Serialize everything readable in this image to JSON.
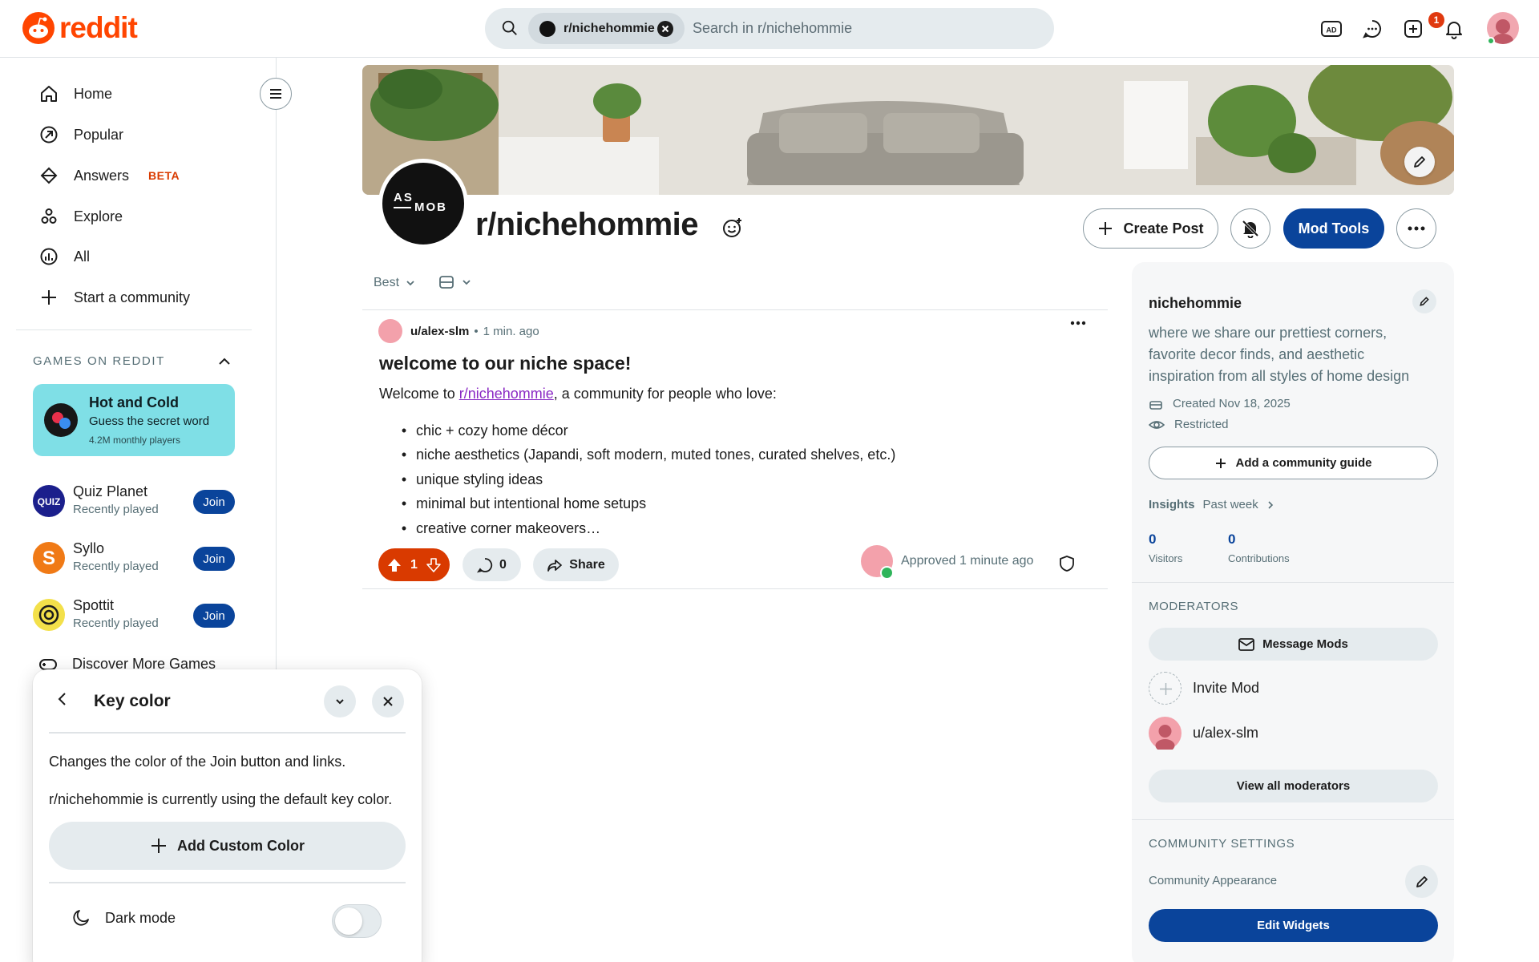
{
  "header": {
    "logo_text": "reddit",
    "search_chip": "r/nichehommie",
    "search_placeholder": "Search in r/nichehommie",
    "notification_count": "1",
    "icons": [
      "advertise-icon",
      "chat-icon",
      "create-icon",
      "notification-bell-icon"
    ]
  },
  "sidebar": {
    "nav": [
      {
        "label": "Home",
        "icon": "home-icon"
      },
      {
        "label": "Popular",
        "icon": "popular-icon"
      },
      {
        "label": "Answers",
        "icon": "answers-icon",
        "badge": "BETA"
      },
      {
        "label": "Explore",
        "icon": "explore-icon"
      },
      {
        "label": "All",
        "icon": "all-icon"
      },
      {
        "label": "Start a community",
        "icon": "plus-icon"
      }
    ],
    "games_section_title": "GAMES ON REDDIT",
    "featured_game": {
      "title": "Hot and Cold",
      "subtitle": "Guess the secret word",
      "players": "4.2M monthly players"
    },
    "games": [
      {
        "name": "Quiz Planet",
        "status": "Recently played",
        "join": "Join",
        "color": "#1b1f8c"
      },
      {
        "name": "Syllo",
        "status": "Recently played",
        "join": "Join",
        "color": "#f07a16"
      },
      {
        "name": "Spottit",
        "status": "Recently played",
        "join": "Join",
        "color": "#f3e04a"
      }
    ],
    "discover": "Discover More Games"
  },
  "popup": {
    "title": "Key color",
    "description": "Changes the color of the Join button and links.",
    "status": "r/nichehommie is currently using the default key color.",
    "add_button": "Add Custom Color",
    "dark_mode": "Dark mode",
    "dark_mode_enabled": false
  },
  "community": {
    "avatar_text": "AS MOB",
    "name": "r/nichehommie",
    "create_post": "Create Post",
    "mod_tools": "Mod Tools"
  },
  "feed": {
    "sort": "Best",
    "post": {
      "author": "u/alex-slm",
      "separator": "•",
      "time": "1 min. ago",
      "title": "welcome to our niche space!",
      "body_prefix": "Welcome to ",
      "body_link": "r/nichehommie",
      "body_suffix": ", a community for people who love:",
      "bullets": [
        "chic + cozy home décor",
        "niche aesthetics (Japandi, soft modern, muted tones, curated shelves, etc.)",
        "unique styling ideas",
        "minimal but intentional home setups",
        "creative corner makeovers…"
      ],
      "votes": "1",
      "comments": "0",
      "share": "Share",
      "approved": "Approved 1 minute ago"
    }
  },
  "right_sidebar": {
    "name": "nichehommie",
    "description": "where we share our prettiest corners, favorite decor finds, and aesthetic inspiration from all styles of home design",
    "created": "Created Nov 18, 2025",
    "visibility": "Restricted",
    "guide_button": "Add a community guide",
    "insights_label": "Insights",
    "insights_period": "Past week",
    "visitors_value": "0",
    "visitors_label": "Visitors",
    "contributions_value": "0",
    "contributions_label": "Contributions",
    "moderators_title": "MODERATORS",
    "message_mods": "Message Mods",
    "invite_mod": "Invite Mod",
    "moderator": "u/alex-slm",
    "view_all": "View all moderators",
    "settings_title": "COMMUNITY SETTINGS",
    "appearance": "Community Appearance",
    "edit_widgets": "Edit Widgets"
  },
  "colors": {
    "brand": "#ff4500",
    "key_blue": "#0a449b",
    "upvote_active": "#d93a00",
    "link_purple": "#8a29c4"
  }
}
